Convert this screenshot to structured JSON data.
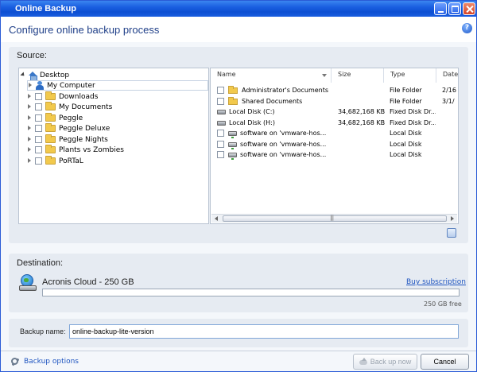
{
  "window": {
    "title": "Online Backup"
  },
  "header": {
    "heading": "Configure online backup process",
    "help_glyph": "?"
  },
  "source": {
    "label": "Source:",
    "tree": [
      {
        "label": "Desktop",
        "icon": "desktop-icon",
        "level": 0,
        "expanded": true
      },
      {
        "label": "My Computer",
        "icon": "computer-icon",
        "level": 1,
        "selected": true
      },
      {
        "label": "Downloads",
        "icon": "folder-icon",
        "level": 1
      },
      {
        "label": "My Documents",
        "icon": "folder-icon",
        "level": 1
      },
      {
        "label": "Peggle",
        "icon": "folder-icon",
        "level": 1
      },
      {
        "label": "Peggle Deluxe",
        "icon": "folder-icon",
        "level": 1
      },
      {
        "label": "Peggle Nights",
        "icon": "folder-icon",
        "level": 1
      },
      {
        "label": "Plants vs Zombies",
        "icon": "folder-icon",
        "level": 1
      },
      {
        "label": "PoRTaL",
        "icon": "folder-icon",
        "level": 1
      }
    ],
    "columns": {
      "name": "Name",
      "size": "Size",
      "type": "Type",
      "date": "Date"
    },
    "files": [
      {
        "name": "Administrator's Documents",
        "size": "",
        "type": "File Folder",
        "date": "2/16",
        "icon": "folder-icon",
        "checkbox": true
      },
      {
        "name": "Shared Documents",
        "size": "",
        "type": "File Folder",
        "date": "3/1/",
        "icon": "folder-icon",
        "checkbox": true
      },
      {
        "name": "Local Disk (C:)",
        "size": "34,682,168 KB",
        "type": "Fixed Disk Dr...",
        "date": "",
        "icon": "disk-icon",
        "checkbox": false
      },
      {
        "name": "Local Disk (H:)",
        "size": "34,682,168 KB",
        "type": "Fixed Disk Dr...",
        "date": "",
        "icon": "disk-icon",
        "checkbox": false
      },
      {
        "name": "software on 'vmware-hos...",
        "size": "",
        "type": "Local Disk",
        "date": "",
        "icon": "network-drive-icon",
        "checkbox": true
      },
      {
        "name": "software on 'vmware-hos...",
        "size": "",
        "type": "Local Disk",
        "date": "",
        "icon": "network-drive-icon",
        "checkbox": true
      },
      {
        "name": "software on 'vmware-hos...",
        "size": "",
        "type": "Local Disk",
        "date": "",
        "icon": "network-drive-icon",
        "checkbox": true
      }
    ]
  },
  "destination": {
    "label": "Destination:",
    "name": "Acronis Cloud - 250 GB",
    "buy_link": "Buy subscription",
    "free": "250 GB free",
    "used_fraction": 0
  },
  "backup_name": {
    "label": "Backup name:",
    "value": "online-backup-lite-version"
  },
  "footer": {
    "options_label": "Backup options",
    "backup_now_label": "Back up now",
    "cancel_label": "Cancel"
  },
  "colors": {
    "accent": "#1f55c0",
    "titlebar": "#1a5ee0",
    "panel": "#e6ebf2"
  }
}
